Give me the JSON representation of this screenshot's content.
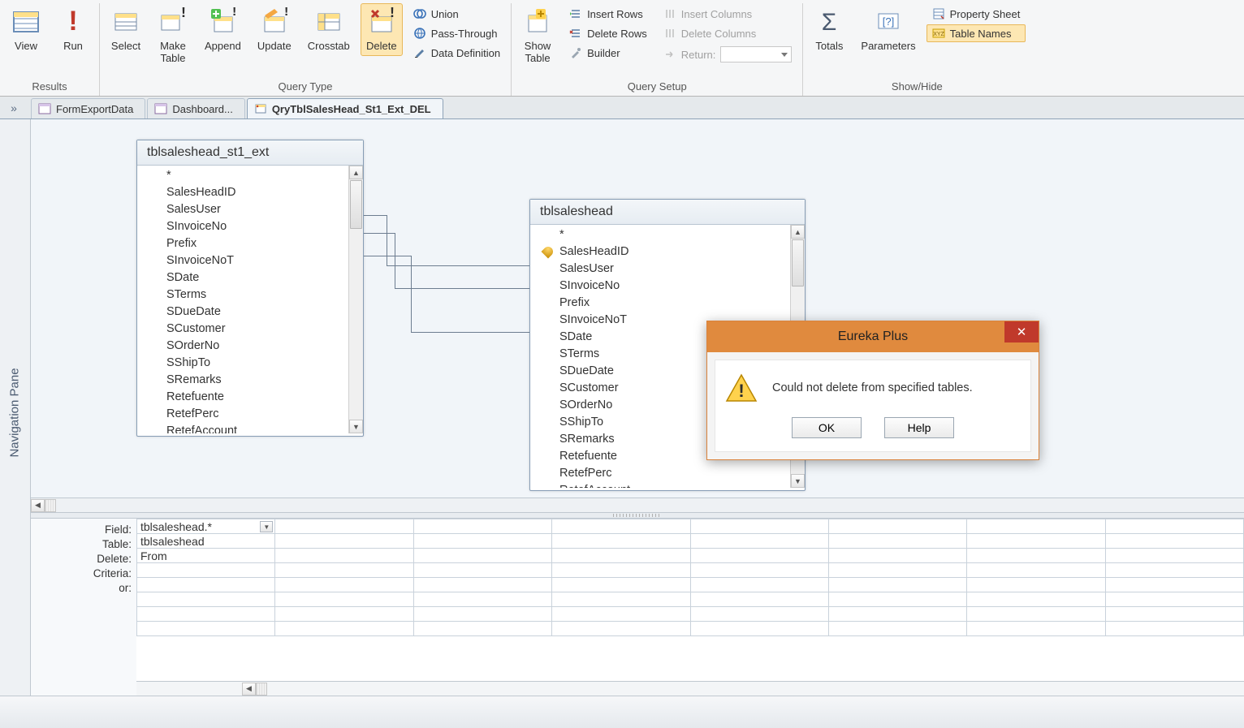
{
  "ribbon": {
    "groups": {
      "results": {
        "label": "Results",
        "view": "View",
        "run": "Run"
      },
      "querytype": {
        "label": "Query Type",
        "select": "Select",
        "maketable": "Make\nTable",
        "append": "Append",
        "update": "Update",
        "crosstab": "Crosstab",
        "delete": "Delete",
        "union": "Union",
        "passthrough": "Pass-Through",
        "datadef": "Data Definition"
      },
      "querysetup": {
        "label": "Query Setup",
        "showtable": "Show\nTable",
        "insertrows": "Insert Rows",
        "deleterows": "Delete Rows",
        "builder": "Builder",
        "insertcols": "Insert Columns",
        "deletecols": "Delete Columns",
        "return": "Return:"
      },
      "showhide": {
        "label": "Show/Hide",
        "totals": "Totals",
        "parameters": "Parameters",
        "propsheet": "Property Sheet",
        "tablenames": "Table Names"
      }
    }
  },
  "nav_toggle": "»",
  "nav_pane_label": "Navigation Pane",
  "tabs": [
    {
      "label": "FormExportData",
      "active": false
    },
    {
      "label": "Dashboard...",
      "active": false
    },
    {
      "label": "QryTblSalesHead_St1_Ext_DEL",
      "active": true
    }
  ],
  "tables": {
    "t1": {
      "title": "tblsaleshead_st1_ext",
      "fields": [
        "*",
        "SalesHeadID",
        "SalesUser",
        "SInvoiceNo",
        "Prefix",
        "SInvoiceNoT",
        "SDate",
        "STerms",
        "SDueDate",
        "SCustomer",
        "SOrderNo",
        "SShipTo",
        "SRemarks",
        "Retefuente",
        "RetefPerc",
        "RetefAccount"
      ],
      "key": null
    },
    "t2": {
      "title": "tblsaleshead",
      "fields": [
        "*",
        "SalesHeadID",
        "SalesUser",
        "SInvoiceNo",
        "Prefix",
        "SInvoiceNoT",
        "SDate",
        "STerms",
        "SDueDate",
        "SCustomer",
        "SOrderNo",
        "SShipTo",
        "SRemarks",
        "Retefuente",
        "RetefPerc",
        "RetefAccount"
      ],
      "key": "SalesHeadID"
    }
  },
  "grid": {
    "labels": {
      "field": "Field:",
      "table": "Table:",
      "delete": "Delete:",
      "criteria": "Criteria:",
      "or": "or:"
    },
    "col0": {
      "field": "tblsaleshead.*",
      "table": "tblsaleshead",
      "delete": "From"
    }
  },
  "dialog": {
    "title": "Eureka Plus",
    "message": "Could not delete from specified tables.",
    "ok": "OK",
    "help": "Help"
  }
}
